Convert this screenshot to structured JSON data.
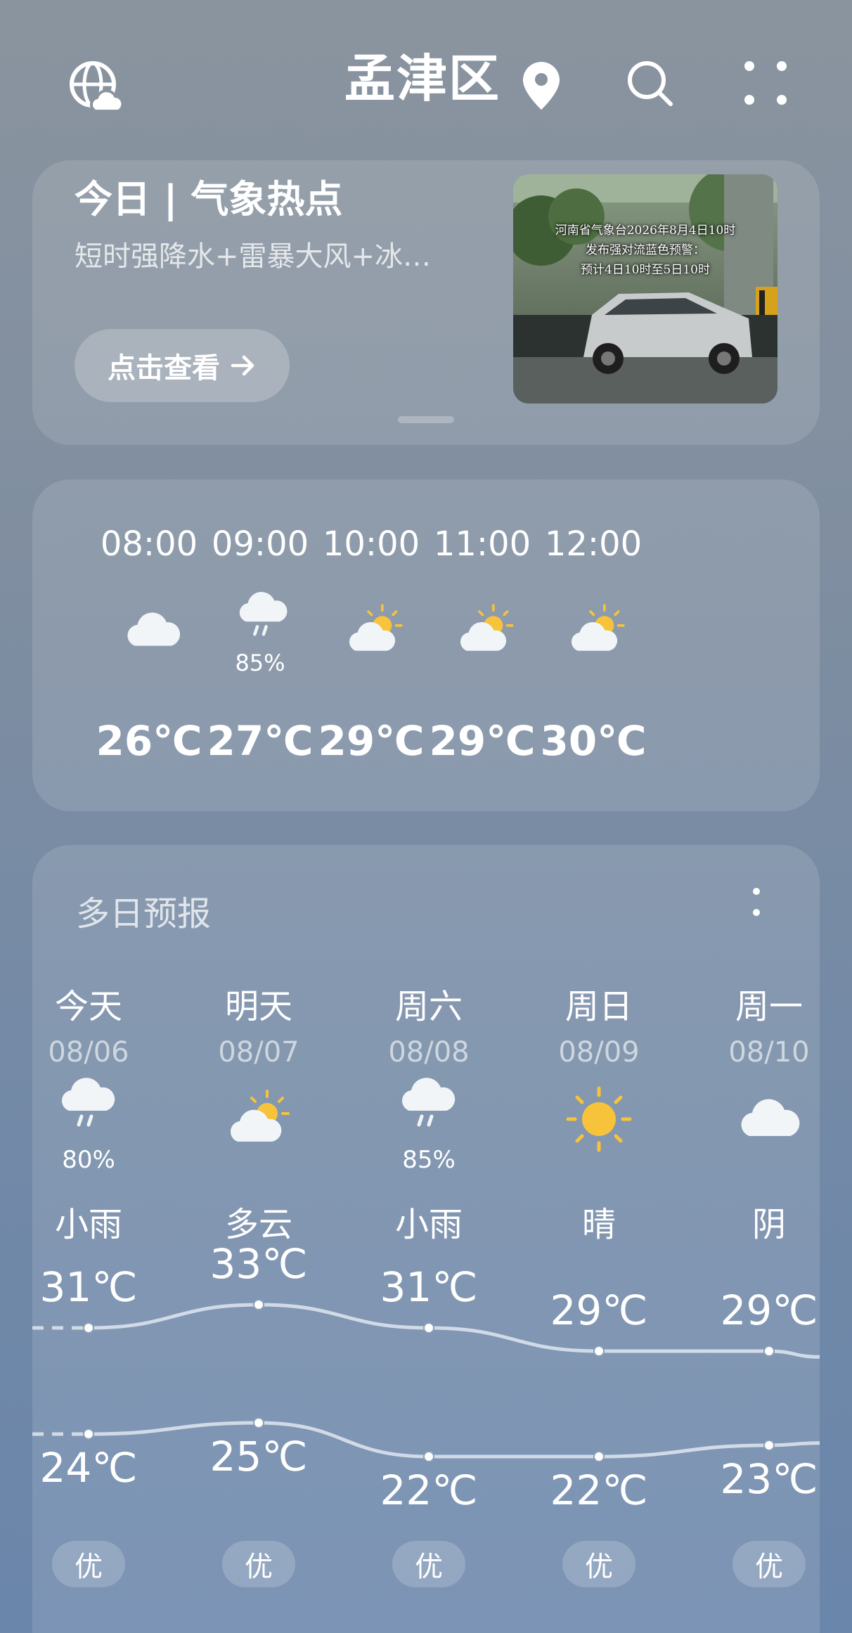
{
  "header": {
    "title": "孟津区"
  },
  "banner": {
    "title": "今日 | 气象热点",
    "subtitle": "短时强降水+雷暴大风+冰…",
    "button_label": "点击查看",
    "thumb_lines": [
      "河南省气象台2026年8月4日10时",
      "发布强对流蓝色预警：",
      "预计4日10时至5日10时"
    ]
  },
  "hourly": [
    {
      "time": "08:00",
      "icon": "cloudy-icon",
      "precip": "",
      "temp": "26℃"
    },
    {
      "time": "09:00",
      "icon": "rain-icon",
      "precip": "85%",
      "temp": "27℃"
    },
    {
      "time": "10:00",
      "icon": "partly-cloudy-icon",
      "precip": "",
      "temp": "29℃"
    },
    {
      "time": "11:00",
      "icon": "partly-cloudy-icon",
      "precip": "",
      "temp": "29℃"
    },
    {
      "time": "12:00",
      "icon": "partly-cloudy-icon",
      "precip": "",
      "temp": "30℃"
    }
  ],
  "daily": {
    "title": "多日预报",
    "days": [
      {
        "day": "今天",
        "date": "08/06",
        "icon": "rain-icon",
        "precip": "80%",
        "condition": "小雨",
        "high": "31℃",
        "low": "24℃",
        "high_value": 31,
        "low_value": 24,
        "aqi": "优"
      },
      {
        "day": "明天",
        "date": "08/07",
        "icon": "partly-cloudy-icon",
        "precip": "",
        "condition": "多云",
        "high": "33℃",
        "low": "25℃",
        "high_value": 33,
        "low_value": 25,
        "aqi": "优"
      },
      {
        "day": "周六",
        "date": "08/08",
        "icon": "rain-icon",
        "precip": "85%",
        "condition": "小雨",
        "high": "31℃",
        "low": "22℃",
        "high_value": 31,
        "low_value": 22,
        "aqi": "优"
      },
      {
        "day": "周日",
        "date": "08/09",
        "icon": "sunny-icon",
        "precip": "",
        "condition": "晴",
        "high": "29℃",
        "low": "22℃",
        "high_value": 29,
        "low_value": 22,
        "aqi": "优"
      },
      {
        "day": "周一",
        "date": "08/10",
        "icon": "cloudy-icon",
        "precip": "",
        "condition": "阴",
        "high": "29℃",
        "low": "23℃",
        "high_value": 29,
        "low_value": 23,
        "aqi": "优"
      }
    ]
  },
  "colors": {
    "sun": "#f6c33b",
    "cloud": "#f2f5f8",
    "line": "#dfe7f0"
  }
}
